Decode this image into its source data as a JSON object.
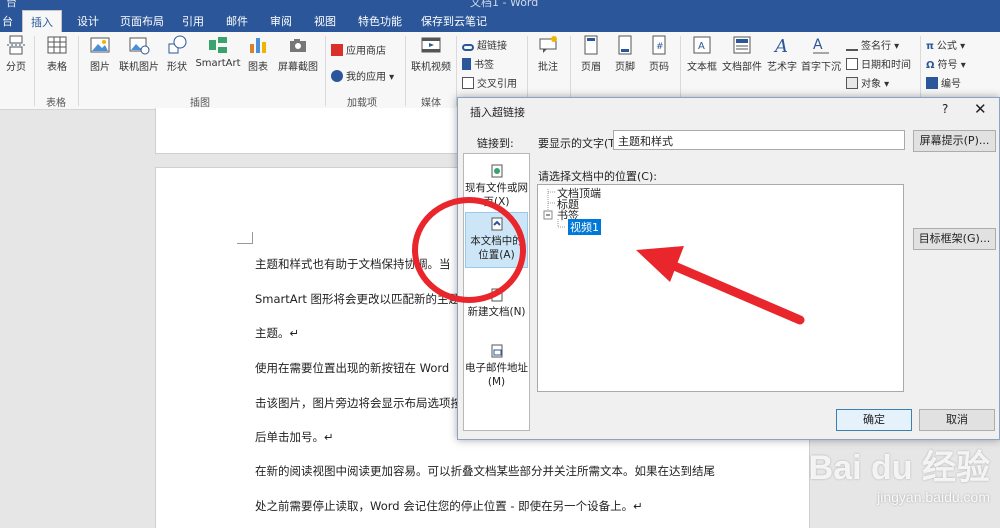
{
  "window": {
    "title": "文档1 - Word",
    "quick_access": "台"
  },
  "tabs": [
    {
      "label": "插入"
    },
    {
      "label": "设计"
    },
    {
      "label": "页面布局"
    },
    {
      "label": "引用"
    },
    {
      "label": "邮件"
    },
    {
      "label": "审阅"
    },
    {
      "label": "视图"
    },
    {
      "label": "特色功能"
    },
    {
      "label": "保存到云笔记"
    }
  ],
  "ribbon": {
    "pages": {
      "page_break": "分页"
    },
    "tables": {
      "table": "表格",
      "group": "表格"
    },
    "illustrations": {
      "picture": "图片",
      "online_picture": "联机图片",
      "shapes": "形状",
      "smartart": "SmartArt",
      "chart": "图表",
      "screenshot": "屏幕截图",
      "group": "插图"
    },
    "addins": {
      "store": "应用商店",
      "my_apps": "我的应用",
      "group": "加载项"
    },
    "media": {
      "online_video": "联机视频",
      "group": "媒体"
    },
    "links": {
      "hyperlink": "超链接",
      "bookmark": "书签",
      "cross_ref": "交叉引用"
    },
    "comments": {
      "comment": "批注"
    },
    "header_footer": {
      "header": "页眉",
      "footer": "页脚",
      "page_number": "页码"
    },
    "text": {
      "text_box": "文本框",
      "quick_parts": "文档部件",
      "wordart": "艺术字",
      "drop_cap": "首字下沉",
      "signature": "签名行",
      "date_time": "日期和时间",
      "object": "对象"
    },
    "symbols": {
      "equation": "公式",
      "symbol": "符号",
      "numbering": "编号"
    }
  },
  "document": {
    "lines": [
      "主题和样式也有助于文档保持协调。当",
      "SmartArt 图形将会更改以匹配新的主题",
      "主题。↵",
      "使用在需要位置出现的新按钮在 Word",
      "击该图片，图片旁边将会显示布局选项按",
      "后单击加号。↵",
      "在新的阅读视图中阅读更加容易。可以折叠文档某些部分并关注所需文本。如果在达到结尾",
      "处之前需要停止读取，Word 会记住您的停止位置 - 即使在另一个设备上。↵"
    ]
  },
  "dialog": {
    "title": "插入超链接",
    "help": "?",
    "close": "✕",
    "link_to_label": "链接到:",
    "link_to_options": [
      {
        "label": "现有文件或网页(X)"
      },
      {
        "label": "本文档中的位置(A)"
      },
      {
        "label": "新建文档(N)"
      },
      {
        "label": "电子邮件地址(M)"
      }
    ],
    "display_text_label": "要显示的文字(T):",
    "display_text_value": "主题和样式",
    "screen_tip_button": "屏幕提示(P)...",
    "select_place_label": "请选择文档中的位置(C):",
    "tree": {
      "top": "文档顶端",
      "headings": "标题",
      "bookmarks": "书签",
      "bookmark_item": "视频1"
    },
    "target_frame_button": "目标框架(G)...",
    "ok_button": "确定",
    "cancel_button": "取消"
  },
  "watermark": {
    "logo": "Bai du 经验",
    "url": "jingyan.baidu.com"
  },
  "colors": {
    "ribbon_blue": "#2b579a",
    "annotation_red": "#e8262b",
    "selection_blue": "#0078d7"
  }
}
